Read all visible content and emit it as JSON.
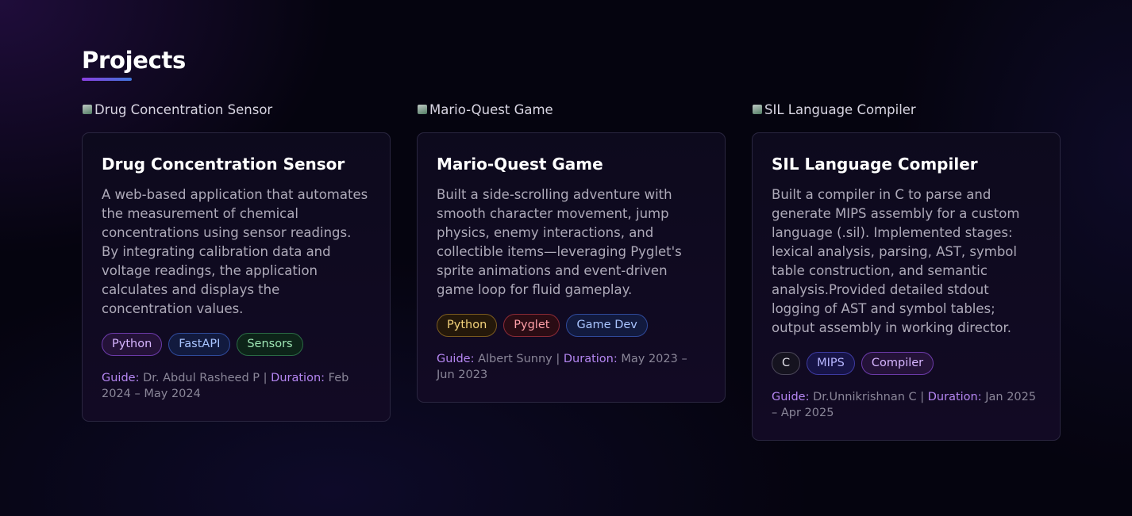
{
  "section": {
    "title": "Projects"
  },
  "projects": [
    {
      "image_alt": "Drug Concentration Sensor",
      "title": "Drug Concentration Sensor",
      "description": "A web-based application that automates the measurement of chemical concentrations using sensor readings. By integrating calibration data and voltage readings, the application calculates and displays the concentration values.",
      "tags": [
        {
          "label": "Python",
          "color": "#d7b6ff"
        },
        {
          "label": "FastAPI",
          "color": "#a9c4ff"
        },
        {
          "label": "Sensors",
          "color": "#9ee6b4"
        }
      ],
      "guide_label": "Guide:",
      "guide": "Dr. Abdul Rasheed P",
      "separator": "|",
      "duration_label": "Duration:",
      "duration": "Feb 2024 – May 2024"
    },
    {
      "image_alt": "Mario-Quest Game",
      "title": "Mario-Quest Game",
      "description": "Built a side-scrolling adventure with smooth character movement, jump physics, enemy interactions, and collectible items—leveraging Pyglet's sprite animations and event-driven game loop for fluid gameplay.",
      "tags": [
        {
          "label": "Python",
          "color": "#f4d37c"
        },
        {
          "label": "Pyglet",
          "color": "#ff9fa8"
        },
        {
          "label": "Game Dev",
          "color": "#a9c4ff"
        }
      ],
      "guide_label": "Guide:",
      "guide": "Albert Sunny",
      "separator": "|",
      "duration_label": "Duration:",
      "duration": "May 2023 – Jun 2023"
    },
    {
      "image_alt": "SIL Language Compiler",
      "title": "SIL Language Compiler",
      "description": "Built a compiler in C to parse and generate MIPS assembly for a custom language (.sil). Implemented stages: lexical analysis, parsing, AST, symbol table construction, and semantic analysis.Provided detailed stdout logging of AST and symbol tables; output assembly in working director.",
      "tags": [
        {
          "label": "C",
          "color": "#e2e0ea"
        },
        {
          "label": "MIPS",
          "color": "#b7b6ff"
        },
        {
          "label": "Compiler",
          "color": "#d7b6ff"
        }
      ],
      "guide_label": "Guide:",
      "guide": "Dr.Unnikrishnan C",
      "separator": "|",
      "duration_label": "Duration:",
      "duration": "Jan 2025 – Apr 2025"
    }
  ]
}
